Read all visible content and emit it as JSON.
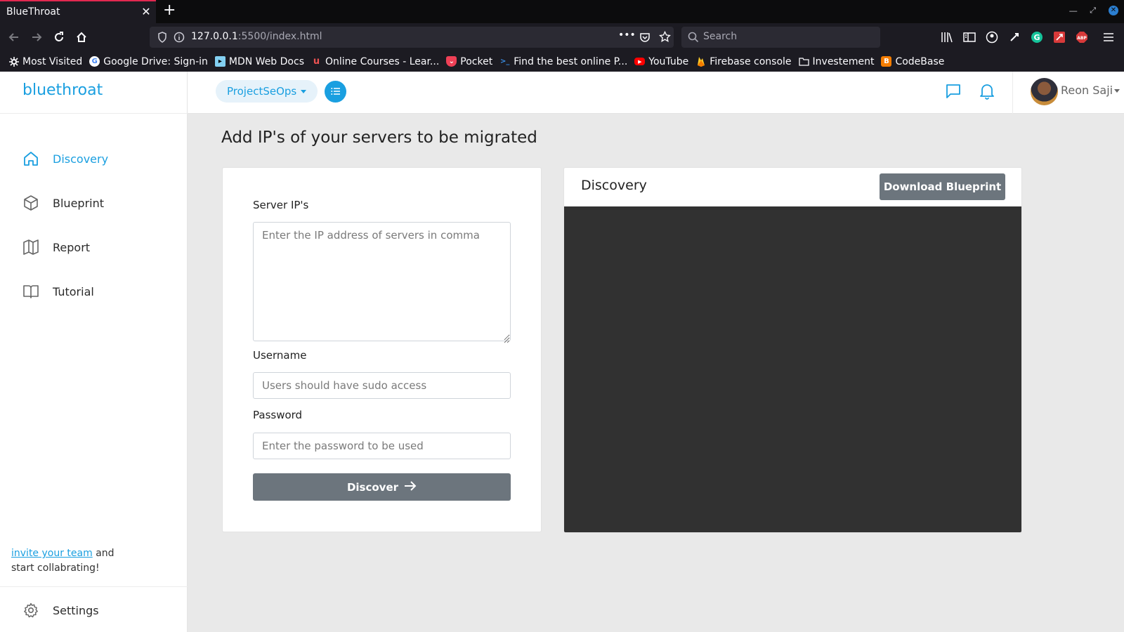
{
  "browser": {
    "tab_title": "BlueThroat",
    "tab_close": "✕",
    "new_tab": "+",
    "url_host": "127.0.0.1",
    "url_rest": ":5500/index.html",
    "search_placeholder": "Search",
    "page_actions_glyph": "•••"
  },
  "bookmarks": [
    {
      "label": "Most Visited",
      "icon": "gear-icon"
    },
    {
      "label": "Google Drive: Sign-in",
      "icon": "google-icon"
    },
    {
      "label": "MDN Web Docs",
      "icon": "mdn-icon"
    },
    {
      "label": "Online Courses - Lear...",
      "icon": "udemy-icon"
    },
    {
      "label": "Pocket",
      "icon": "pocket-icon"
    },
    {
      "label": "Find the best online P...",
      "icon": "code-icon"
    },
    {
      "label": "YouTube",
      "icon": "youtube-icon"
    },
    {
      "label": "Firebase console",
      "icon": "firebase-icon"
    },
    {
      "label": "Investement",
      "icon": "folder-icon"
    },
    {
      "label": "CodeBase",
      "icon": "blogger-icon"
    }
  ],
  "brand": "bluethroat",
  "sidebar": {
    "items": [
      {
        "label": "Discovery",
        "icon": "home-icon",
        "active": true
      },
      {
        "label": "Blueprint",
        "icon": "cube-icon",
        "active": false
      },
      {
        "label": "Report",
        "icon": "map-icon",
        "active": false
      },
      {
        "label": "Tutorial",
        "icon": "book-icon",
        "active": false
      }
    ],
    "invite_link": "invite your team",
    "invite_text_1": " and",
    "invite_text_2": "start collabrating!",
    "settings_label": "Settings"
  },
  "header": {
    "project_name": "ProjectSeOps",
    "user_name": "Reon Saji"
  },
  "main": {
    "page_title": "Add IP's of your servers to be migrated",
    "form": {
      "server_ips_label": "Server IP's",
      "server_ips_placeholder": "Enter the IP address of servers in comma",
      "username_label": "Username",
      "username_placeholder": "Users should have sudo access",
      "password_label": "Password",
      "password_placeholder": "Enter the password to be used",
      "discover_button": "Discover"
    },
    "discovery_panel": {
      "title": "Discovery",
      "download_button": "Download Blueprint"
    }
  },
  "colors": {
    "accent": "#1a9fe0",
    "button_gray": "#6c757d",
    "terminal_bg": "#313131"
  }
}
